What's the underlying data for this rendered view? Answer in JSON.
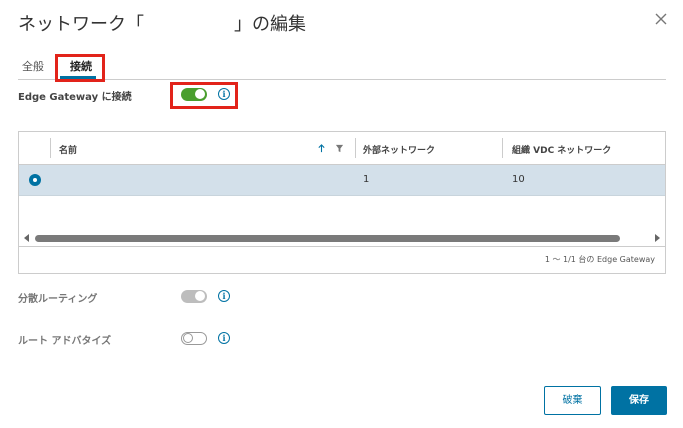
{
  "dialog": {
    "title": "ネットワーク「　　　　　」の編集"
  },
  "tabs": [
    {
      "label": "全般"
    },
    {
      "label": "接続"
    }
  ],
  "edge_gateway": {
    "label": "Edge Gateway に接続",
    "enabled": true
  },
  "grid": {
    "columns": [
      "名前",
      "外部ネットワーク",
      "組織 VDC ネットワーク"
    ],
    "rows": [
      {
        "name": "",
        "external_network": "1",
        "org_vdc_network": "10",
        "selected": true
      }
    ],
    "footer": "1 ～ 1/1 台の Edge Gateway"
  },
  "distributed_routing": {
    "label": "分散ルーティング",
    "enabled": true,
    "disabled_state": true
  },
  "route_advertise": {
    "label": "ルート アドバタイズ",
    "enabled": false
  },
  "buttons": {
    "cancel": "破棄",
    "save": "保存"
  },
  "colors": {
    "accent": "#0072a3",
    "toggle_on": "#4a9e2e",
    "highlight_box": "#e2231a",
    "selected_row": "#d3e0ea"
  }
}
